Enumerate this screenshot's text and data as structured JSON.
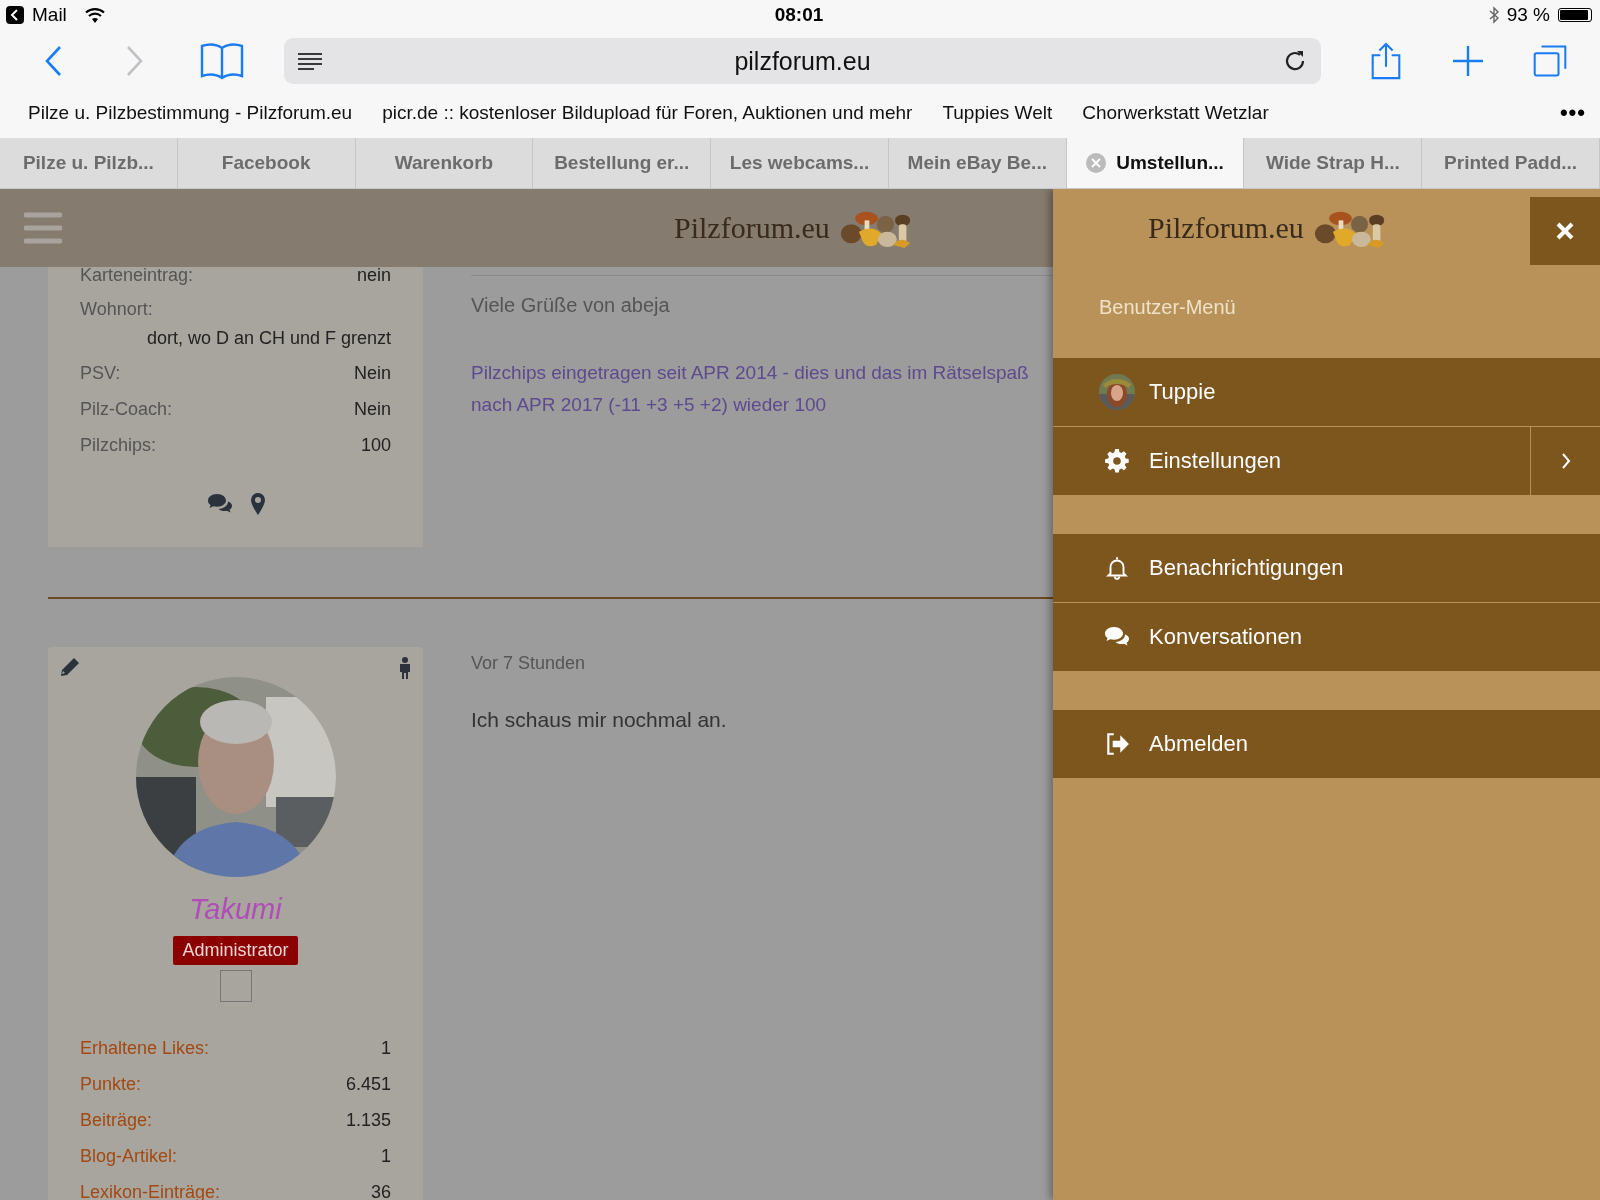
{
  "status_bar": {
    "back_app": "Mail",
    "time": "08:01",
    "battery": "93 %"
  },
  "toolbar": {
    "back_enabled": true,
    "forward_enabled": false,
    "address": "pilzforum.eu"
  },
  "favorites": {
    "items": [
      "Pilze u. Pilzbestimmung - Pilzforum.eu",
      "picr.de :: kostenloser Bildupload für Foren, Auktionen und mehr",
      "Tuppies Welt",
      "Chorwerkstatt Wetzlar"
    ],
    "more": "•••"
  },
  "tabs": [
    {
      "label": "Pilze u. Pilzb...",
      "selected": false
    },
    {
      "label": "Facebook",
      "selected": false
    },
    {
      "label": "Warenkorb",
      "selected": false
    },
    {
      "label": "Bestellung er...",
      "selected": false
    },
    {
      "label": "Les webcams...",
      "selected": false
    },
    {
      "label": "Mein eBay Be...",
      "selected": false
    },
    {
      "label": "Umstellun...",
      "selected": true
    },
    {
      "label": "Wide Strap H...",
      "selected": false
    },
    {
      "label": "Printed Padd...",
      "selected": false
    }
  ],
  "page": {
    "logo": "Pilzforum.eu",
    "posts": [
      {
        "author_fields": [
          {
            "label": "Karteneintrag:",
            "value": "nein",
            "kind": "inline"
          },
          {
            "label": "Wohnort:",
            "value": "dort, wo D an CH und F grenzt",
            "kind": "stacked"
          },
          {
            "label": "PSV:",
            "value": "Nein",
            "kind": "inline"
          },
          {
            "label": "Pilz-Coach:",
            "value": "Nein",
            "kind": "inline"
          },
          {
            "label": "Pilzchips:",
            "value": "100",
            "kind": "inline"
          }
        ],
        "greeting": "Viele Grüße von abeja",
        "signature": "Pilzchips eingetragen seit APR 2014 - dies und das im Rätselspaß\nnach APR 2017 (-11 +3 +5 +2) wieder 100"
      },
      {
        "author": {
          "name": "Takumi",
          "role": "Administrator",
          "stats": [
            {
              "label": "Erhaltene Likes:",
              "value": "1"
            },
            {
              "label": "Punkte:",
              "value": "6.451"
            },
            {
              "label": "Beiträge:",
              "value": "1.135"
            },
            {
              "label": "Blog-Artikel:",
              "value": "1"
            },
            {
              "label": "Lexikon-Einträge:",
              "value": "36"
            }
          ]
        },
        "time": "Vor 7 Stunden",
        "message": "Ich schaus mir nochmal an."
      }
    ]
  },
  "menu": {
    "logo": "Pilzforum.eu",
    "title": "Benutzer-Menü",
    "groups": [
      [
        {
          "label": "Tuppie",
          "kind": "user",
          "submenu": false
        },
        {
          "label": "Einstellungen",
          "kind": "settings",
          "submenu": true
        }
      ],
      [
        {
          "label": "Benachrichtigungen",
          "kind": "notifications",
          "submenu": false
        },
        {
          "label": "Konversationen",
          "kind": "conversations",
          "submenu": false
        }
      ],
      [
        {
          "label": "Abmelden",
          "kind": "logout",
          "submenu": false
        }
      ]
    ]
  }
}
